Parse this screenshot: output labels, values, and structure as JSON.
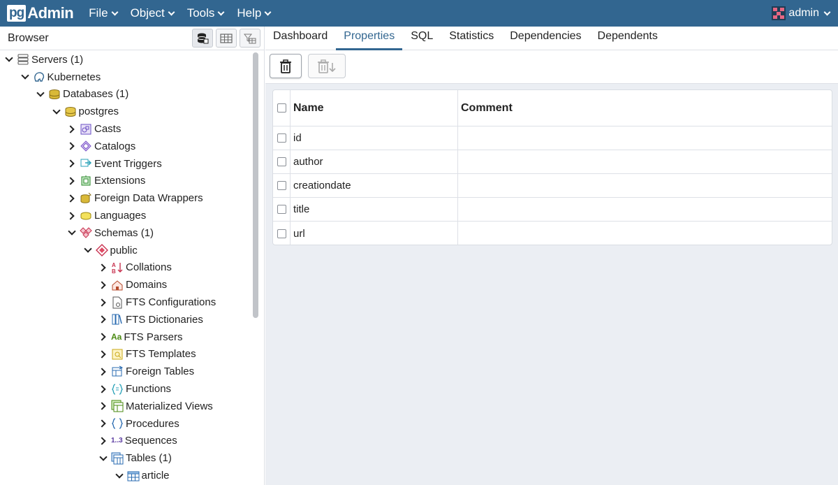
{
  "app": {
    "logo_pg": "pg",
    "logo_admin": "Admin"
  },
  "menu": [
    "File",
    "Object",
    "Tools",
    "Help"
  ],
  "user": {
    "name": "admin"
  },
  "browser": {
    "title": "Browser",
    "tree": [
      {
        "label": "Servers (1)",
        "depth": 0,
        "state": "open",
        "icon": "servers-icon"
      },
      {
        "label": "Kubernetes",
        "depth": 1,
        "state": "open",
        "icon": "postgres-elephant-icon"
      },
      {
        "label": "Databases (1)",
        "depth": 2,
        "state": "open",
        "icon": "databases-icon"
      },
      {
        "label": "postgres",
        "depth": 3,
        "state": "open",
        "icon": "database-icon"
      },
      {
        "label": "Casts",
        "depth": 4,
        "state": "closed",
        "icon": "casts-icon"
      },
      {
        "label": "Catalogs",
        "depth": 4,
        "state": "closed",
        "icon": "catalogs-icon"
      },
      {
        "label": "Event Triggers",
        "depth": 4,
        "state": "closed",
        "icon": "event-triggers-icon"
      },
      {
        "label": "Extensions",
        "depth": 4,
        "state": "closed",
        "icon": "extensions-icon"
      },
      {
        "label": "Foreign Data Wrappers",
        "depth": 4,
        "state": "closed",
        "icon": "foreign-data-wrappers-icon"
      },
      {
        "label": "Languages",
        "depth": 4,
        "state": "closed",
        "icon": "languages-icon"
      },
      {
        "label": "Schemas (1)",
        "depth": 4,
        "state": "open",
        "icon": "schemas-icon"
      },
      {
        "label": "public",
        "depth": 5,
        "state": "open",
        "icon": "schema-icon"
      },
      {
        "label": "Collations",
        "depth": 6,
        "state": "closed",
        "icon": "collations-icon"
      },
      {
        "label": "Domains",
        "depth": 6,
        "state": "closed",
        "icon": "domains-icon"
      },
      {
        "label": "FTS Configurations",
        "depth": 6,
        "state": "closed",
        "icon": "fts-configurations-icon"
      },
      {
        "label": "FTS Dictionaries",
        "depth": 6,
        "state": "closed",
        "icon": "fts-dictionaries-icon"
      },
      {
        "label": "FTS Parsers",
        "depth": 6,
        "state": "closed",
        "icon": "fts-parsers-icon",
        "glyph": "Aa"
      },
      {
        "label": "FTS Templates",
        "depth": 6,
        "state": "closed",
        "icon": "fts-templates-icon"
      },
      {
        "label": "Foreign Tables",
        "depth": 6,
        "state": "closed",
        "icon": "foreign-tables-icon"
      },
      {
        "label": "Functions",
        "depth": 6,
        "state": "closed",
        "icon": "functions-icon"
      },
      {
        "label": "Materialized Views",
        "depth": 6,
        "state": "closed",
        "icon": "materialized-views-icon"
      },
      {
        "label": "Procedures",
        "depth": 6,
        "state": "closed",
        "icon": "procedures-icon"
      },
      {
        "label": "Sequences",
        "depth": 6,
        "state": "closed",
        "icon": "sequences-icon",
        "glyph": "1..3"
      },
      {
        "label": "Tables (1)",
        "depth": 6,
        "state": "open",
        "icon": "tables-icon"
      },
      {
        "label": "article",
        "depth": 7,
        "state": "open",
        "icon": "table-icon"
      }
    ]
  },
  "tabs": [
    {
      "label": "Dashboard",
      "active": false
    },
    {
      "label": "Properties",
      "active": true
    },
    {
      "label": "SQL",
      "active": false
    },
    {
      "label": "Statistics",
      "active": false
    },
    {
      "label": "Dependencies",
      "active": false
    },
    {
      "label": "Dependents",
      "active": false
    }
  ],
  "grid": {
    "headers": {
      "name": "Name",
      "comment": "Comment"
    },
    "rows": [
      {
        "name": "id",
        "comment": ""
      },
      {
        "name": "author",
        "comment": ""
      },
      {
        "name": "creationdate",
        "comment": ""
      },
      {
        "name": "title",
        "comment": ""
      },
      {
        "name": "url",
        "comment": ""
      }
    ]
  },
  "colors": {
    "navbar": "#326690",
    "accent": "#326690"
  }
}
